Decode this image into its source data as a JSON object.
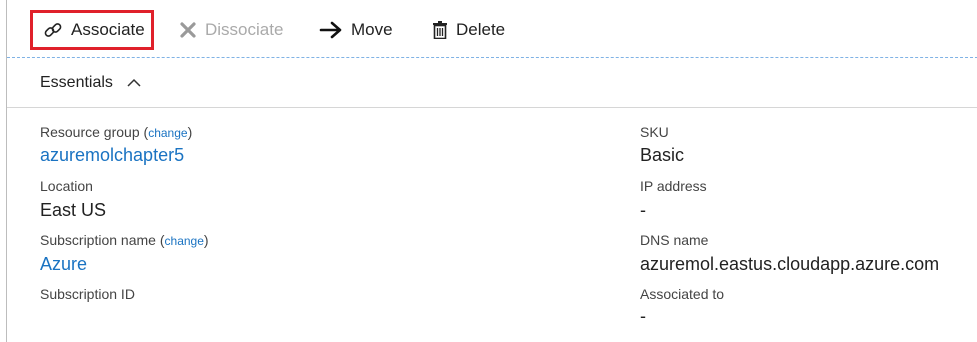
{
  "toolbar": {
    "associate_label": "Associate",
    "dissociate_label": "Dissociate",
    "move_label": "Move",
    "delete_label": "Delete"
  },
  "essentials": {
    "title": "Essentials",
    "left": {
      "resource_group_label": "Resource group",
      "resource_group_change": "change",
      "resource_group_value": "azuremolchapter5",
      "location_label": "Location",
      "location_value": "East US",
      "subscription_name_label": "Subscription name",
      "subscription_name_change": "change",
      "subscription_name_value": "Azure",
      "subscription_id_label": "Subscription ID"
    },
    "right": {
      "sku_label": "SKU",
      "sku_value": "Basic",
      "ip_label": "IP address",
      "ip_value": "-",
      "dns_label": "DNS name",
      "dns_value": "azuremol.eastus.cloudapp.azure.com",
      "associated_label": "Associated to",
      "associated_value": "-"
    }
  },
  "colors": {
    "link": "#1a73c2",
    "highlight_border": "#e0202a",
    "disabled": "#aaaaaa"
  }
}
